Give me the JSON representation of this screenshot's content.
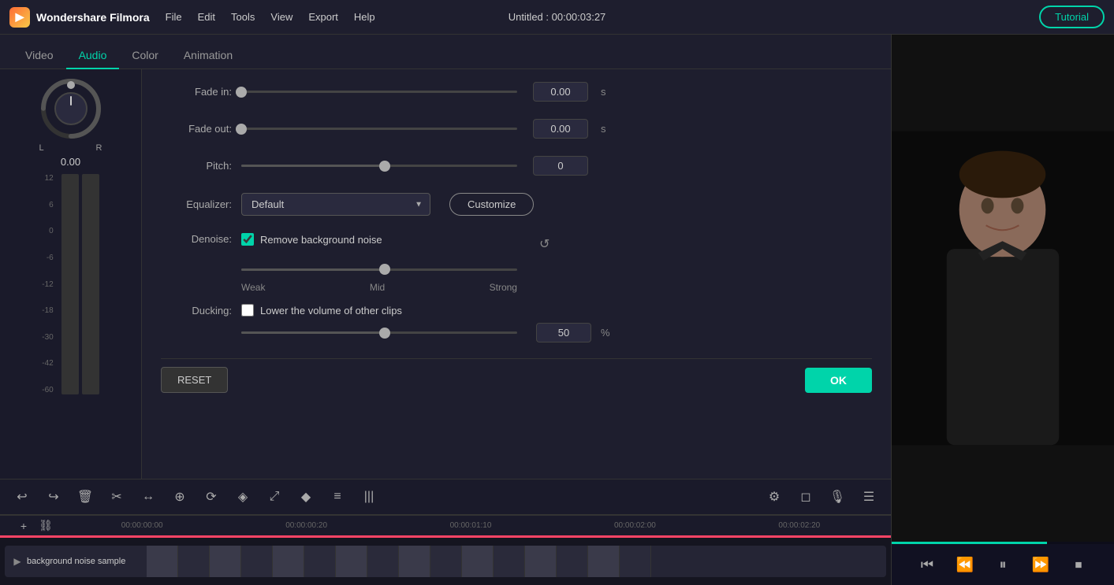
{
  "app": {
    "name": "Wondershare Filmora",
    "title": "Untitled : 00:00:03:27",
    "tutorial_label": "Tutorial"
  },
  "menu": {
    "items": [
      "File",
      "Edit",
      "Tools",
      "View",
      "Export",
      "Help"
    ]
  },
  "tabs": {
    "items": [
      "Video",
      "Audio",
      "Color",
      "Animation"
    ],
    "active": "Audio"
  },
  "audio_panel": {
    "fade_in_label": "Fade in:",
    "fade_in_value": "0.00",
    "fade_in_unit": "s",
    "fade_out_label": "Fade out:",
    "fade_out_value": "0.00",
    "fade_out_unit": "s",
    "pitch_label": "Pitch:",
    "pitch_value": "0",
    "equalizer_label": "Equalizer:",
    "equalizer_value": "Default",
    "customize_label": "Customize",
    "denoise_label": "Denoise:",
    "denoise_checkbox_label": "Remove background noise",
    "denoise_weak": "Weak",
    "denoise_mid": "Mid",
    "denoise_strong": "Strong",
    "ducking_label": "Ducking:",
    "ducking_checkbox_label": "Lower the volume of other clips",
    "ducking_value": "50",
    "ducking_unit": "%",
    "reset_label": "RESET",
    "ok_label": "OK"
  },
  "volume_meter": {
    "knob_value": "0.00",
    "knob_label_l": "L",
    "knob_label_r": "R",
    "scale": [
      "12",
      "6",
      "0",
      "-6",
      "-12",
      "-18",
      "-30",
      "-42",
      "-60"
    ]
  },
  "toolbar": {
    "tools": [
      "↩",
      "↪",
      "🗑",
      "✂",
      "↔",
      "🔍",
      "⟳",
      "◈",
      "⤢",
      "◆",
      "≡",
      "|||"
    ]
  },
  "timeline": {
    "timestamps": [
      "00:00:00:00",
      "00:00:00:20",
      "00:00:01:10",
      "00:00:02:00",
      "00:00:02:20"
    ],
    "track_label": "background noise sample"
  },
  "playback": {
    "rewind": "⏮",
    "play_prev": "⏪",
    "play": "⏸",
    "play_next": "⏩",
    "stop": "⏹"
  }
}
